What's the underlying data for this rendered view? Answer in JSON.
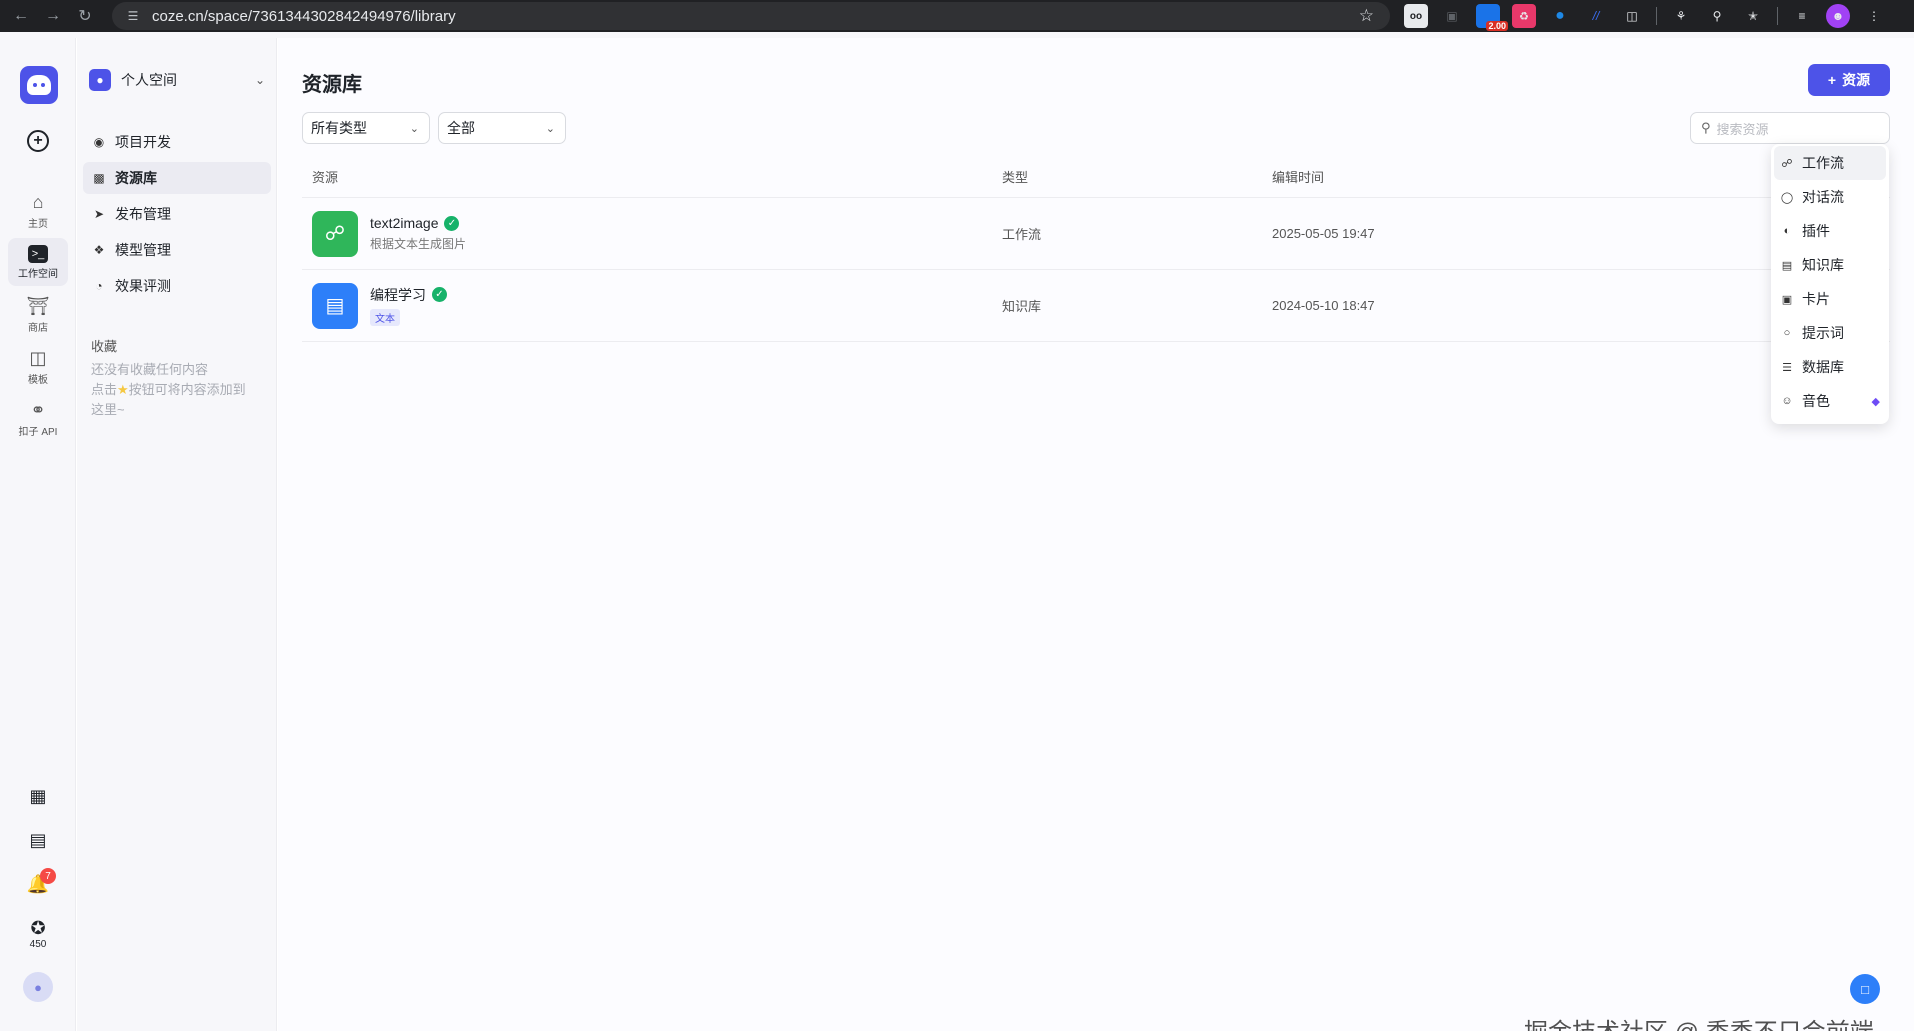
{
  "browser": {
    "url": "coze.cn/space/7361344302842494976/library",
    "ext_badge": "2.00"
  },
  "rail": {
    "items": [
      {
        "label": "主页"
      },
      {
        "label": "工作空间"
      },
      {
        "label": "商店"
      },
      {
        "label": "模板"
      },
      {
        "label": "扣子 API"
      }
    ],
    "notification_count": "7",
    "points": "450"
  },
  "sidebar": {
    "space_name": "个人空间",
    "menu": [
      {
        "label": "项目开发",
        "icon": "project-icon"
      },
      {
        "label": "资源库",
        "icon": "library-icon"
      },
      {
        "label": "发布管理",
        "icon": "rocket-icon"
      },
      {
        "label": "模型管理",
        "icon": "model-icon"
      },
      {
        "label": "效果评测",
        "icon": "evaluate-icon"
      }
    ],
    "favorites_title": "收藏",
    "favorites_empty_1": "还没有收藏任何内容",
    "favorites_empty_2a": "点击",
    "favorites_empty_2b": "按钮可将内容添加到",
    "favorites_empty_3": "这里~"
  },
  "main": {
    "title": "资源库",
    "add_button": "资源",
    "filter_type": "所有类型",
    "filter_scope": "全部",
    "search_placeholder": "搜索资源",
    "columns": {
      "resource": "资源",
      "type": "类型",
      "time": "编辑时间"
    },
    "rows": [
      {
        "name": "text2image",
        "desc": "根据文本生成图片",
        "type": "工作流",
        "time": "2025-05-05 19:47",
        "color": "#2fb65a"
      },
      {
        "name": "编程学习",
        "tag": "文本",
        "type": "知识库",
        "time": "2024-05-10 18:47",
        "color": "#2d7ff9"
      }
    ]
  },
  "dropdown": {
    "items": [
      {
        "label": "工作流",
        "icon": "workflow-icon"
      },
      {
        "label": "对话流",
        "icon": "chatflow-icon"
      },
      {
        "label": "插件",
        "icon": "plugin-icon"
      },
      {
        "label": "知识库",
        "icon": "knowledge-icon"
      },
      {
        "label": "卡片",
        "icon": "card-icon"
      },
      {
        "label": "提示词",
        "icon": "prompt-icon"
      },
      {
        "label": "数据库",
        "icon": "database-icon"
      },
      {
        "label": "音色",
        "icon": "voice-icon"
      }
    ]
  },
  "watermark": "掘金技术社区 @ 秀秀不只会前端",
  "colors": {
    "accent": "#4d53e8",
    "success": "#17b26a"
  }
}
